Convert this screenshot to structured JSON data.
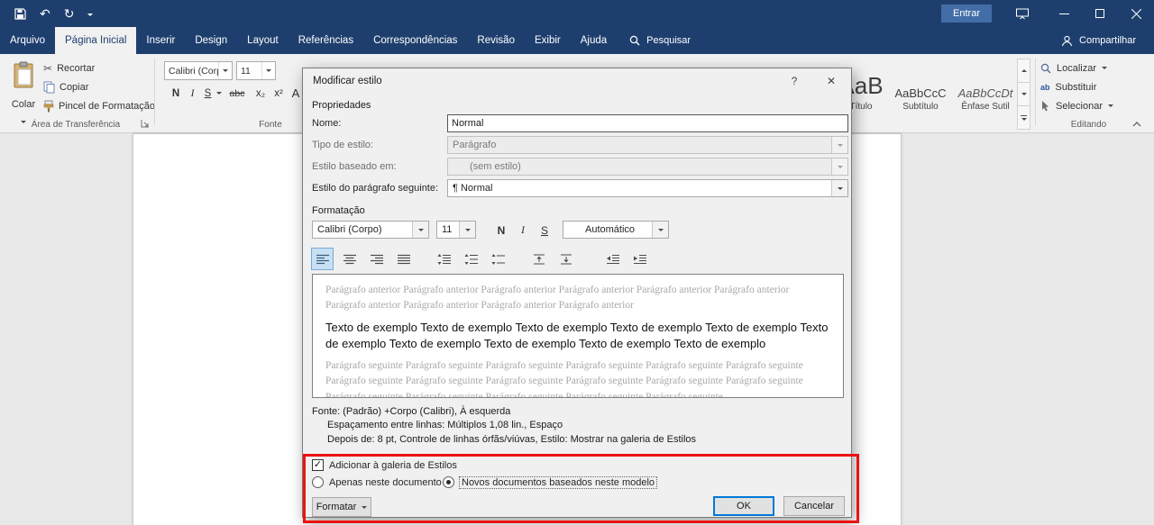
{
  "colors": {
    "titlebar_blue": "#1e3f6e",
    "accent_blue": "#2b579a",
    "annotation_red": "#ee1111",
    "selection_blue": "#c8e0f4"
  },
  "titlebar": {
    "entrar": "Entrar"
  },
  "tabs": {
    "file": "Arquivo",
    "items": [
      "Página Inicial",
      "Inserir",
      "Design",
      "Layout",
      "Referências",
      "Correspondências",
      "Revisão",
      "Exibir",
      "Ajuda"
    ],
    "search": "Pesquisar",
    "share": "Compartilhar"
  },
  "ribbon": {
    "paste": "Colar",
    "cut": "Recortar",
    "copy": "Copiar",
    "format_painter": "Pincel de Formatação",
    "clipboard_group": "Área de Transferência",
    "font_name": "Calibri (Corp",
    "font_size": "11",
    "bold": "N",
    "italic": "I",
    "underline": "S",
    "strikethrough": "abc",
    "subscript": "x₂",
    "superscript": "x²",
    "grow_font": "A",
    "font_group": "Fonte",
    "styles": [
      {
        "preview": "AaB",
        "label": "Título"
      },
      {
        "preview": "AaBbCcC",
        "label": "Subtítulo"
      },
      {
        "preview": "AaBbCcDt",
        "label": "Ênfase Sutil"
      }
    ],
    "find": "Localizar",
    "replace": "Substituir",
    "replace_icon_text": "ab",
    "select": "Selecionar",
    "editing_group": "Editando"
  },
  "dialog": {
    "title": "Modificar estilo",
    "properties_section": "Propriedades",
    "name_label": "Nome:",
    "name_value": "Normal",
    "type_label": "Tipo de estilo:",
    "type_value": "Parágrafo",
    "based_on_label": "Estilo baseado em:",
    "based_on_value": "(sem estilo)",
    "next_style_label": "Estilo do parágrafo seguinte:",
    "next_style_value": "¶ Normal",
    "formatting_section": "Formatação",
    "font_name": "Calibri (Corpo)",
    "font_size": "11",
    "bold": "N",
    "italic": "I",
    "underline": "S",
    "font_color": "Automático",
    "preview_before": "Parágrafo anterior Parágrafo anterior Parágrafo anterior Parágrafo anterior Parágrafo anterior Parágrafo anterior Parágrafo anterior Parágrafo anterior Parágrafo anterior Parágrafo anterior",
    "preview_sample": "Texto de exemplo Texto de exemplo Texto de exemplo Texto de exemplo Texto de exemplo Texto de exemplo Texto de exemplo Texto de exemplo Texto de exemplo Texto de exemplo",
    "preview_after": "Parágrafo seguinte Parágrafo seguinte Parágrafo seguinte Parágrafo seguinte Parágrafo seguinte Parágrafo seguinte Parágrafo seguinte Parágrafo seguinte Parágrafo seguinte Parágrafo seguinte Parágrafo seguinte Parágrafo seguinte Parágrafo seguinte Parágrafo seguinte Parágrafo seguinte Parágrafo seguinte Parágrafo seguinte",
    "description_lines": [
      "Fonte: (Padrão) +Corpo (Calibri), À esquerda",
      "Espaçamento entre linhas:  Múltiplos 1,08 lin., Espaço",
      "Depois de:  8 pt, Controle de linhas órfãs/viúvas, Estilo: Mostrar na galeria de Estilos"
    ],
    "add_to_gallery": "Adicionar à galeria de Estilos",
    "only_this_doc": "Apenas neste documento",
    "new_docs_template": "Novos documentos baseados neste modelo",
    "format_button": "Formatar",
    "ok_button": "OK",
    "cancel_button": "Cancelar",
    "help_button": "?",
    "close_button": "✕"
  },
  "icons": {
    "undo": "↶",
    "redo": "↻",
    "check": "✓"
  }
}
